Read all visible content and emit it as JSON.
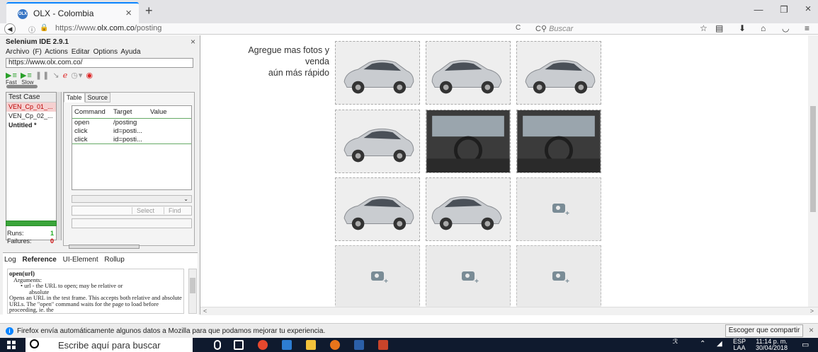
{
  "browser": {
    "tab_title": "OLX - Colombia",
    "tab_favicon": "OLX",
    "url_prefix": "https://www.",
    "url_domain": "olx.com.co",
    "url_path": "/posting",
    "search_placeholder": "Buscar"
  },
  "ide": {
    "title": "Selenium IDE 2.9.1",
    "menu": [
      "Archivo (F)",
      "Actions",
      "Editar",
      "Options",
      "Ayuda"
    ],
    "base_url": "https://www.olx.com.co/",
    "speed_fast": "Fast",
    "speed_slow": "Slow",
    "testcase_header": "Test Case",
    "testcases": [
      "VEN_Cp_01_...",
      "VEN_Cp_02_...",
      "Untitled *"
    ],
    "tab_table": "Table",
    "tab_source": "Source",
    "columns": [
      "Command",
      "Target",
      "Value"
    ],
    "rows": [
      {
        "command": "open",
        "target": "/posting",
        "value": ""
      },
      {
        "command": "click",
        "target": "id=posti...",
        "value": ""
      },
      {
        "command": "click",
        "target": "id=posti...",
        "value": ""
      }
    ],
    "select_label": "Select",
    "find_label": "Find",
    "runs_label": "Runs:",
    "runs_value": "1",
    "failures_label": "Failures:",
    "failures_value": "0",
    "bottom_tabs": [
      "Log",
      "Reference",
      "UI-Element",
      "Rollup"
    ],
    "ref_fn": "open(url)",
    "ref_args_label": "Arguments:",
    "ref_arg": "• url - the URL to open; may be relative or",
    "ref_arg2": "absolute",
    "ref_desc": "Opens an URL in the test frame. This accepts both relative and absolute URLs. The \"open\" command waits for the page to load before proceeding, ie. the"
  },
  "page": {
    "heading_line1": "Agregue mas fotos y venda",
    "heading_line2": "aún más rápido",
    "grid": [
      [
        "photo",
        "photo",
        "photo"
      ],
      [
        "photo",
        "photo",
        "photo"
      ],
      [
        "photo",
        "photo",
        "empty"
      ],
      [
        "empty",
        "empty",
        "empty"
      ]
    ]
  },
  "notification": {
    "text": "Firefox envía automáticamente algunos datos a Mozilla para que podamos mejorar tu experiencia.",
    "button": "Escoger que compartir"
  },
  "taskbar": {
    "search_text": "Escribe aquí para buscar",
    "lang1": "ESP",
    "lang2": "LAA",
    "time": "11:14 p. m.",
    "date": "30/04/2018"
  },
  "colors": {
    "accent": "#0a84ff",
    "ide_pass": "#3aa53a",
    "taskbar": "#0f1a2e"
  }
}
